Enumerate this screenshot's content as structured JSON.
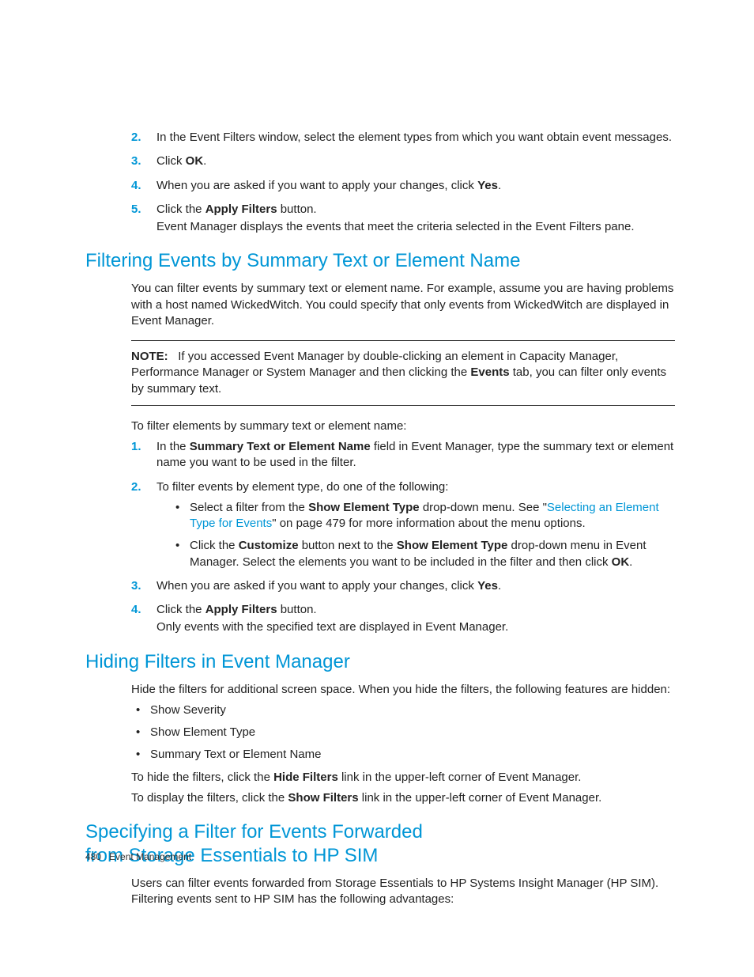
{
  "steps1": {
    "s2": "In the Event Filters window, select the element types from which you want obtain event messages.",
    "s3_pre": "Click ",
    "s3_bold": "OK",
    "s3_post": ".",
    "s4_pre": "When you are asked if you want to apply your changes, click ",
    "s4_bold": "Yes",
    "s4_post": ".",
    "s5_pre": "Click the ",
    "s5_bold": "Apply Filters",
    "s5_post": " button.",
    "s5_follow": "Event Manager displays the events that meet the criteria selected in the Event Filters pane."
  },
  "sec1": {
    "title": "Filtering Events by Summary Text or Element Name",
    "intro": "You can filter events by summary text or element name. For example, assume you are having problems with a host named WickedWitch. You could specify that only events from WickedWitch are displayed in Event Manager.",
    "note_label": "NOTE:",
    "note_body_a": "If you accessed Event Manager by double-clicking an element in Capacity Manager, Performance Manager or System Manager and then clicking the ",
    "note_bold": "Events",
    "note_body_b": " tab, you can filter only events by summary text.",
    "lead": "To filter elements by summary text or element name:",
    "step1_a": "In the ",
    "step1_bold": "Summary Text or Element Name",
    "step1_b": " field in Event Manager, type the summary text or element name you want to be used in the filter.",
    "step2": "To filter events by element type, do one of the following:",
    "step2_b1_a": "Select a filter from the ",
    "step2_b1_bold": "Show Element Type",
    "step2_b1_b": " drop-down menu. See \"",
    "step2_b1_link": "Selecting an Element Type for Events",
    "step2_b1_c": "\" on page 479 for more information about the menu options.",
    "step2_b2_a": "Click the ",
    "step2_b2_bold1": "Customize",
    "step2_b2_b": " button next to the ",
    "step2_b2_bold2": "Show Element Type",
    "step2_b2_c": " drop-down menu in Event Manager. Select the elements you want to be included in the filter and then click ",
    "step2_b2_bold3": "OK",
    "step2_b2_d": ".",
    "step3_a": "When you are asked if you want to apply your changes, click ",
    "step3_bold": "Yes",
    "step3_b": ".",
    "step4_a": "Click the ",
    "step4_bold": "Apply Filters",
    "step4_b": " button.",
    "step4_follow": "Only events with the specified text are displayed in Event Manager."
  },
  "sec2": {
    "title": "Hiding Filters in Event Manager",
    "intro": "Hide the filters for additional screen space. When you hide the filters, the following features are hidden:",
    "b1": "Show Severity",
    "b2": "Show Element Type",
    "b3": "Summary Text or Element Name",
    "p1_a": "To hide the filters, click the ",
    "p1_bold": "Hide Filters",
    "p1_b": " link in the upper-left corner of Event Manager.",
    "p2_a": "To display the filters, click the ",
    "p2_bold": "Show Filters",
    "p2_b": " link in the upper-left corner of Event Manager."
  },
  "sec3": {
    "title_line1": "Specifying a Filter for Events Forwarded",
    "title_line2": "from Storage Essentials to HP SIM",
    "intro": "Users can filter events forwarded from Storage Essentials to HP Systems Insight Manager (HP SIM). Filtering events sent to HP SIM has the following advantages:"
  },
  "footer": {
    "page": "480",
    "chapter": "Event Management"
  }
}
